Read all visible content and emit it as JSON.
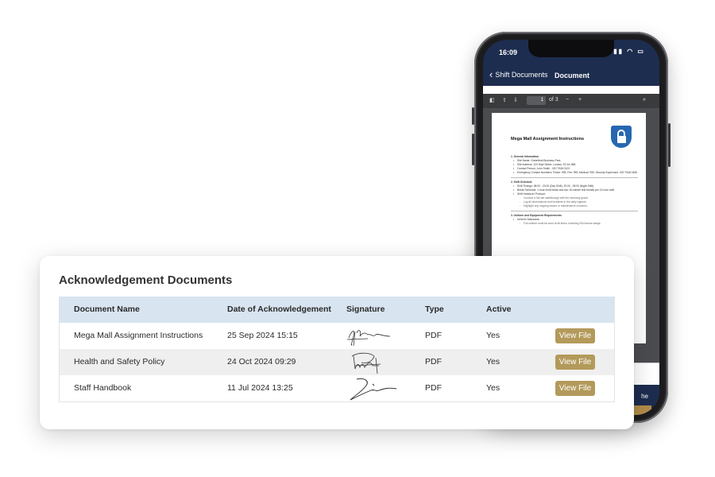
{
  "phone": {
    "status": {
      "time": "16:09",
      "icons": "wifi-battery"
    },
    "nav": {
      "back_label": "Shift Documents",
      "title": "Document"
    },
    "pdf_toolbar": {
      "page_current": "1",
      "page_total": "of 3"
    },
    "document": {
      "title": "Mega Mall Assignment Instructions",
      "sections": [
        {
          "heading": "1. General Information",
          "items": [
            "Site Name: Greenfield Business Park",
            "Site Address: 123 High Street, London, EC1A 1BB",
            "Contact Person: John Smith - 020 7946 0123",
            "Emergency Contact Numbers: Police: 999, Fire: 999, Medical: 999, Security Supervisor: 020 7946 0456"
          ]
        },
        {
          "heading": "2. Shift Schedule",
          "items": [
            "Shift Timings: 08:00 - 20:00 (Day Shift), 20:00 - 08:00 (Night Shift)",
            "Break Schedule: 1-hour meal break and two 15-minute rest breaks per 12-hour shift.",
            "Shift Handover Protocol:"
          ],
          "subitems": [
            "Conduct a full site walkthrough with the incoming guard.",
            "Log all observations and incidents in the daily logbook.",
            "Highlight any ongoing issues or maintenance concerns."
          ]
        },
        {
          "heading": "3. Uniform and Equipment Requirements",
          "items": [
            "Uniform Standards:"
          ],
          "subitems": [
            "Full uniform must be worn at all times, including SIA license badge."
          ]
        }
      ]
    },
    "bottom_text": "he"
  },
  "card": {
    "title": "Acknowledgement Documents",
    "columns": [
      "Document Name",
      "Date of Acknowledgement",
      "Signature",
      "Type",
      "Active",
      ""
    ],
    "rows": [
      {
        "name": "Mega Mall Assignment Instructions",
        "date": "25 Sep 2024 15:15",
        "type": "PDF",
        "active": "Yes",
        "action": "View File"
      },
      {
        "name": "Health and Safety Policy",
        "date": "24 Oct 2024 09:29",
        "type": "PDF",
        "active": "Yes",
        "action": "View File"
      },
      {
        "name": "Staff Handbook",
        "date": "11 Jul 2024 13:25",
        "type": "PDF",
        "active": "Yes",
        "action": "View File"
      }
    ]
  },
  "colors": {
    "navy": "#1d2d4f",
    "gold_button": "#b39a5b",
    "header_blue": "#d8e4f0",
    "lock_blue": "#2767b1"
  }
}
